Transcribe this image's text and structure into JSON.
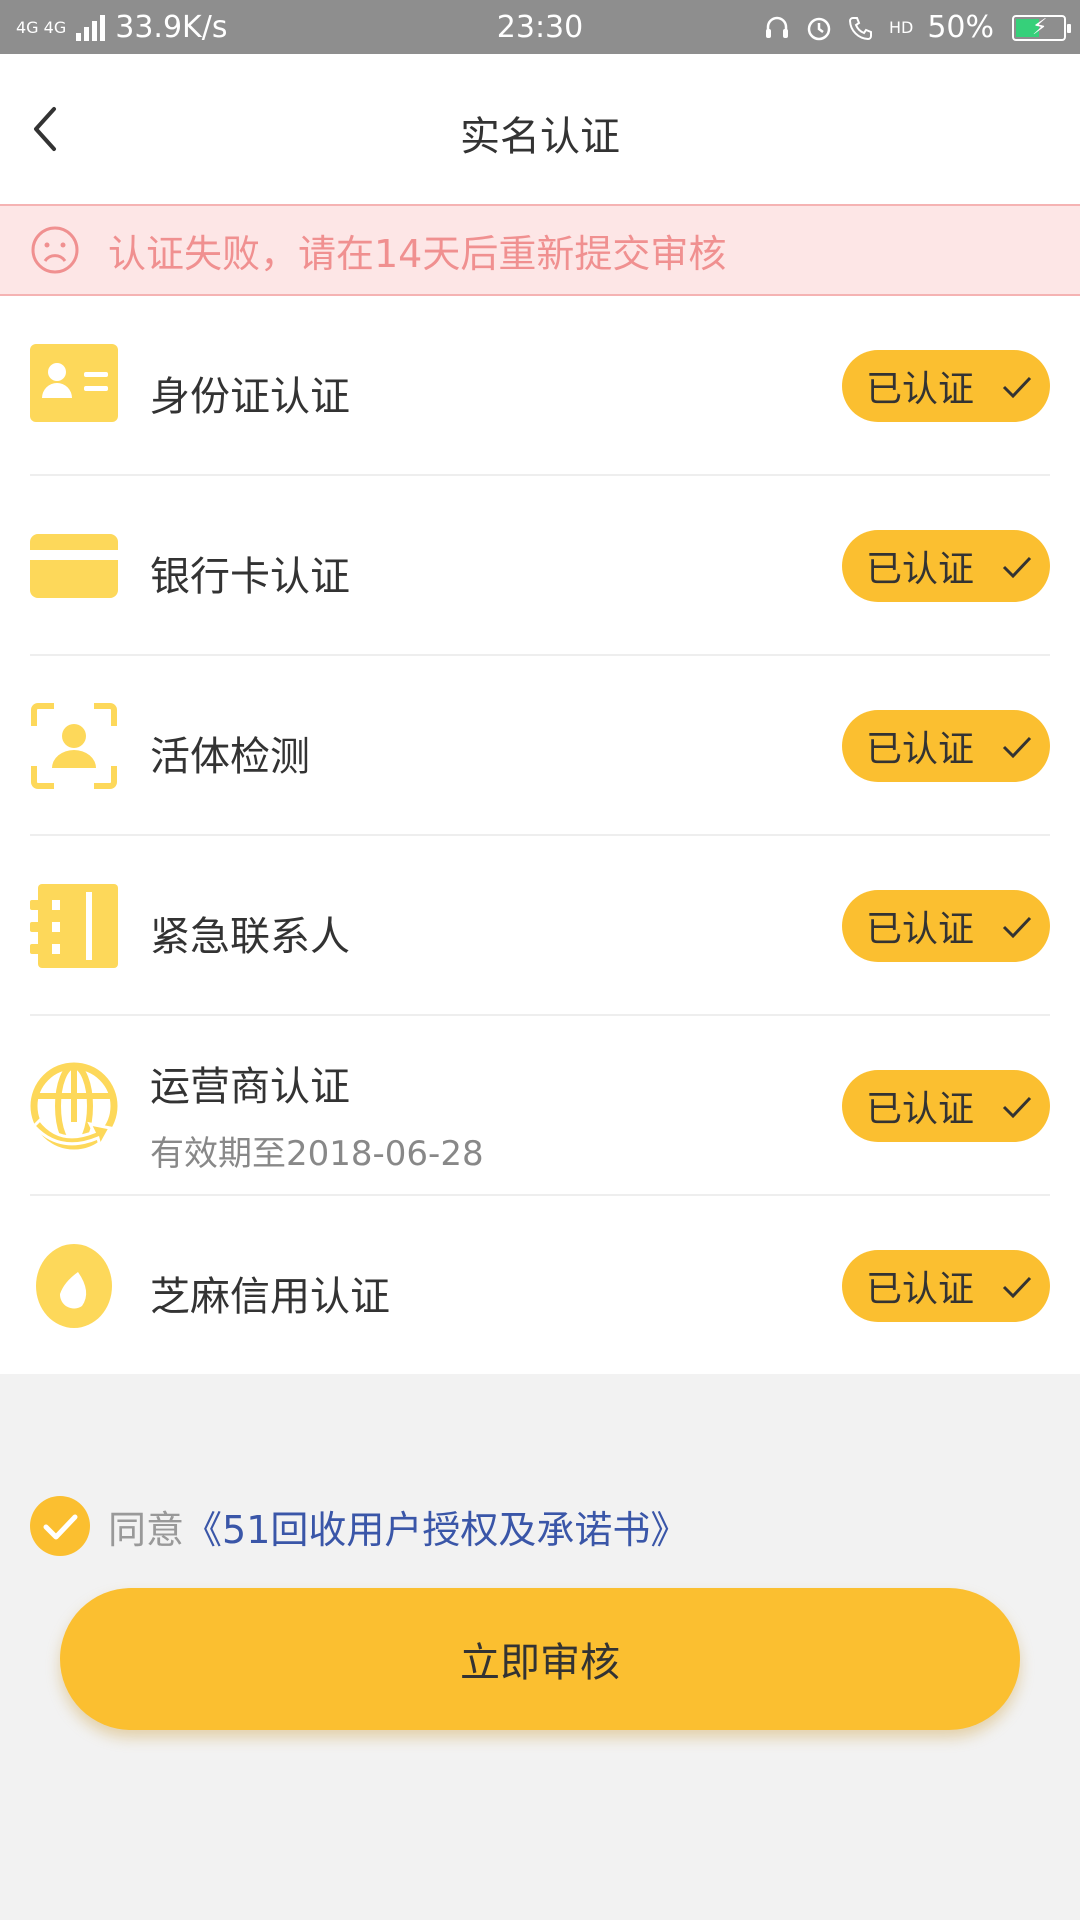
{
  "status_bar": {
    "network_tag": "4G 4G",
    "speed": "33.9K/s",
    "time": "23:30",
    "hd_tag": "HD",
    "battery_percent": "50%",
    "battery_level": 0.5,
    "battery_color": "#36d07a"
  },
  "header": {
    "title": "实名认证"
  },
  "alert": {
    "text": "认证失败，请在14天后重新提交审核",
    "color": "#f09090"
  },
  "accent_color": "#fbbf30",
  "items": [
    {
      "title": "身份证认证",
      "status": "已认证",
      "icon": "id-card-icon"
    },
    {
      "title": "银行卡认证",
      "status": "已认证",
      "icon": "bank-card-icon"
    },
    {
      "title": "活体检测",
      "status": "已认证",
      "icon": "face-scan-icon"
    },
    {
      "title": "紧急联系人",
      "status": "已认证",
      "icon": "contact-book-icon"
    },
    {
      "title": "运营商认证",
      "subtitle": "有效期至2018-06-28",
      "status": "已认证",
      "icon": "globe-icon"
    },
    {
      "title": "芝麻信用认证",
      "status": "已认证",
      "icon": "sesame-icon"
    }
  ],
  "agreement": {
    "label": "同意",
    "link": "《51回收用户授权及承诺书》",
    "checked": true
  },
  "submit": {
    "label": "立即审核"
  }
}
